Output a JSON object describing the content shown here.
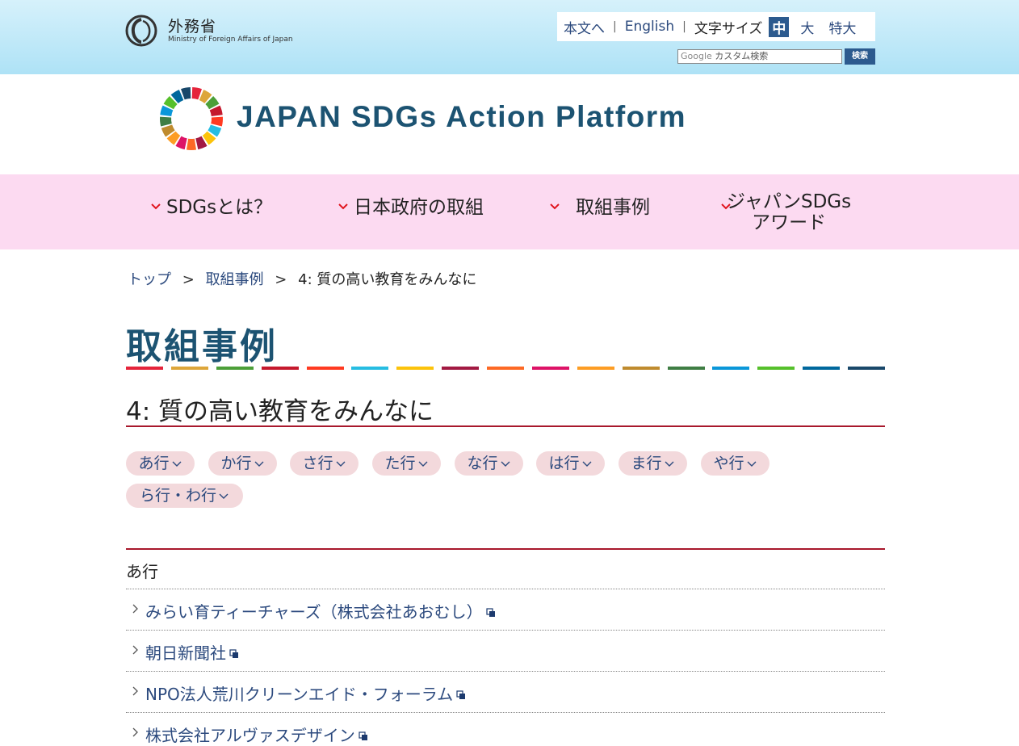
{
  "header": {
    "ministry_name": "外務省",
    "ministry_subtitle": "Ministry of Foreign Affairs of Japan",
    "utility": {
      "skip_link": "本文へ",
      "english_link": "English",
      "font_size_label": "文字サイズ",
      "size_medium": "中",
      "size_large": "大",
      "size_xlarge": "特大"
    },
    "search": {
      "brand": "Google",
      "placeholder": "カスタム検索",
      "button_label": "検索"
    }
  },
  "platform": {
    "title": "JAPAN SDGs Action Platform"
  },
  "global_nav": {
    "items": [
      {
        "label": "SDGsとは？"
      },
      {
        "label": "日本政府の取組"
      },
      {
        "label": "取組事例"
      },
      {
        "label_line1": "ジャパンSDGs",
        "label_line2": "アワード"
      }
    ]
  },
  "breadcrumb": {
    "items": [
      {
        "label": "トップ"
      },
      {
        "label": "取組事例"
      },
      {
        "label": "4: 質の高い教育をみんなに"
      }
    ],
    "separator": ">"
  },
  "page": {
    "title": "取組事例",
    "section_title": "4: 質の高い教育をみんなに",
    "goal_colors": [
      "#e5243b",
      "#dda63a",
      "#4c9f38",
      "#c5192d",
      "#ff3a21",
      "#26bde2",
      "#fcc30b",
      "#a21942",
      "#fd6925",
      "#dd1367",
      "#fd9d24",
      "#bf8b2e",
      "#3f7e44",
      "#0a97d9",
      "#56c02b",
      "#00689d",
      "#19486a"
    ]
  },
  "kana_filters": [
    {
      "label": "あ行"
    },
    {
      "label": "か行"
    },
    {
      "label": "さ行"
    },
    {
      "label": "た行"
    },
    {
      "label": "な行"
    },
    {
      "label": "は行"
    },
    {
      "label": "ま行"
    },
    {
      "label": "や行"
    },
    {
      "label": "ら行・わ行"
    }
  ],
  "group": {
    "label": "あ行",
    "items": [
      {
        "label": "みらい育ティーチャーズ（株式会社あおむし）"
      },
      {
        "label": "朝日新聞社"
      },
      {
        "label": "NPO法人荒川クリーンエイド・フォーラム"
      },
      {
        "label": "株式会社アルヴァスデザイン"
      }
    ]
  }
}
